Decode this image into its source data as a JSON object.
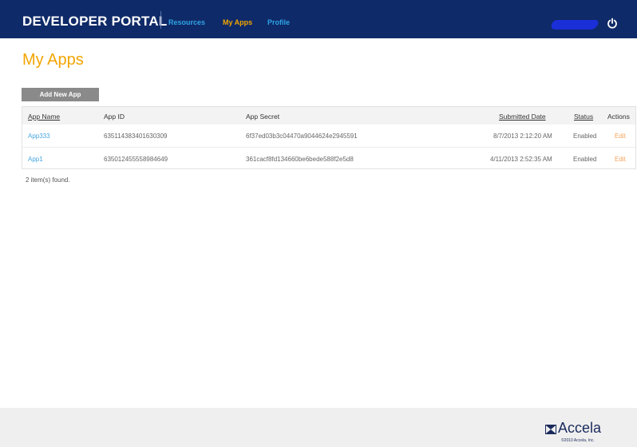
{
  "header": {
    "brand": "DEVELOPER PORTAL",
    "nav": [
      {
        "label": "Resources",
        "active": false
      },
      {
        "label": "My Apps",
        "active": true
      },
      {
        "label": "Profile",
        "active": false
      }
    ],
    "user_name_redacted": true,
    "power_icon": "power-icon",
    "colors": {
      "bar": "#0f2a68",
      "link": "#2fa3e6",
      "active": "#f2a500"
    }
  },
  "page": {
    "title": "My Apps",
    "add_button_label": "Add New App"
  },
  "table": {
    "columns": [
      "App Name",
      "App ID",
      "App Secret",
      "Submitted Date",
      "Status",
      "Actions"
    ],
    "rows": [
      {
        "name": "App333",
        "id": "635114383401630309",
        "secret": "6f37ed03b3c04470a9044624e2945591",
        "submitted": "8/7/2013 2:12:20 AM",
        "status": "Enabled",
        "action": "Edit"
      },
      {
        "name": "App1",
        "id": "635012455558984649",
        "secret": "361cacf8fd134660be6bede588f2e5d8",
        "submitted": "4/11/2013 2:52:35 AM",
        "status": "Enabled",
        "action": "Edit"
      }
    ],
    "count_text": "2 item(s) found."
  },
  "footer": {
    "logo_text": "Accela",
    "copyright": "©2010 Accela, Inc."
  }
}
